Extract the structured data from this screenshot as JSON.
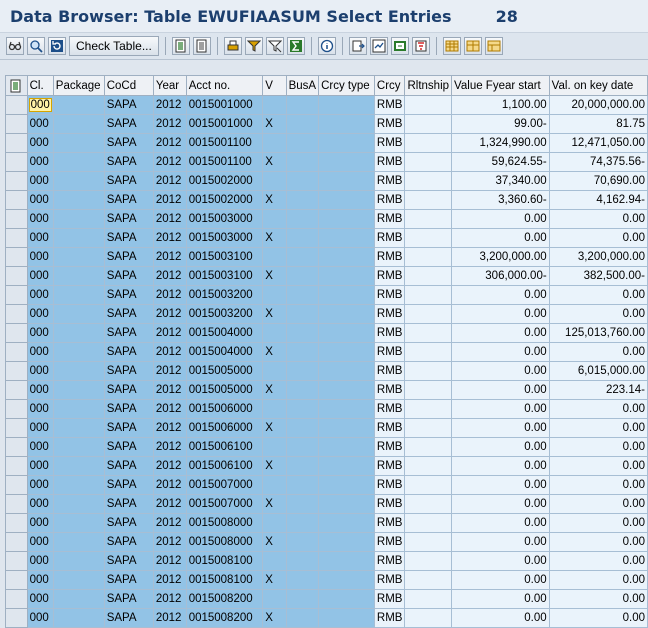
{
  "window": {
    "title": "Data Browser: Table EWUFIAASUM Select Entries",
    "count": "28"
  },
  "toolbar": {
    "icons": [
      "glasses-icon",
      "detail-icon",
      "refresh-icon",
      "check-table-button",
      "select-icon",
      "deselect-icon",
      "print-icon",
      "filter-icon",
      "filter-alt-icon",
      "sum-icon",
      "info-icon",
      "export-icon",
      "spreadsheet-icon",
      "local-file-icon",
      "sort-icon",
      "grid-icon",
      "layout-icon",
      "layout-alt-icon"
    ],
    "check_table_label": "Check Table..."
  },
  "table": {
    "columns": [
      "Cl.",
      "Package",
      "CoCd",
      "Year",
      "Acct no.",
      "V",
      "BusA",
      "Crcy type",
      "Crcy",
      "Rltnship",
      "Value Fyear start",
      "Val. on key date"
    ],
    "rows": [
      [
        "000",
        "",
        "SAPA",
        "2012",
        "0015001000",
        "",
        "",
        "",
        "RMB",
        "",
        "1,100.00",
        "20,000,000.00"
      ],
      [
        "000",
        "",
        "SAPA",
        "2012",
        "0015001000",
        "X",
        "",
        "",
        "RMB",
        "",
        "99.00-",
        "81.75"
      ],
      [
        "000",
        "",
        "SAPA",
        "2012",
        "0015001100",
        "",
        "",
        "",
        "RMB",
        "",
        "1,324,990.00",
        "12,471,050.00"
      ],
      [
        "000",
        "",
        "SAPA",
        "2012",
        "0015001100",
        "X",
        "",
        "",
        "RMB",
        "",
        "59,624.55-",
        "74,375.56-"
      ],
      [
        "000",
        "",
        "SAPA",
        "2012",
        "0015002000",
        "",
        "",
        "",
        "RMB",
        "",
        "37,340.00",
        "70,690.00"
      ],
      [
        "000",
        "",
        "SAPA",
        "2012",
        "0015002000",
        "X",
        "",
        "",
        "RMB",
        "",
        "3,360.60-",
        "4,162.94-"
      ],
      [
        "000",
        "",
        "SAPA",
        "2012",
        "0015003000",
        "",
        "",
        "",
        "RMB",
        "",
        "0.00",
        "0.00"
      ],
      [
        "000",
        "",
        "SAPA",
        "2012",
        "0015003000",
        "X",
        "",
        "",
        "RMB",
        "",
        "0.00",
        "0.00"
      ],
      [
        "000",
        "",
        "SAPA",
        "2012",
        "0015003100",
        "",
        "",
        "",
        "RMB",
        "",
        "3,200,000.00",
        "3,200,000.00"
      ],
      [
        "000",
        "",
        "SAPA",
        "2012",
        "0015003100",
        "X",
        "",
        "",
        "RMB",
        "",
        "306,000.00-",
        "382,500.00-"
      ],
      [
        "000",
        "",
        "SAPA",
        "2012",
        "0015003200",
        "",
        "",
        "",
        "RMB",
        "",
        "0.00",
        "0.00"
      ],
      [
        "000",
        "",
        "SAPA",
        "2012",
        "0015003200",
        "X",
        "",
        "",
        "RMB",
        "",
        "0.00",
        "0.00"
      ],
      [
        "000",
        "",
        "SAPA",
        "2012",
        "0015004000",
        "",
        "",
        "",
        "RMB",
        "",
        "0.00",
        "125,013,760.00"
      ],
      [
        "000",
        "",
        "SAPA",
        "2012",
        "0015004000",
        "X",
        "",
        "",
        "RMB",
        "",
        "0.00",
        "0.00"
      ],
      [
        "000",
        "",
        "SAPA",
        "2012",
        "0015005000",
        "",
        "",
        "",
        "RMB",
        "",
        "0.00",
        "6,015,000.00"
      ],
      [
        "000",
        "",
        "SAPA",
        "2012",
        "0015005000",
        "X",
        "",
        "",
        "RMB",
        "",
        "0.00",
        "223.14-"
      ],
      [
        "000",
        "",
        "SAPA",
        "2012",
        "0015006000",
        "",
        "",
        "",
        "RMB",
        "",
        "0.00",
        "0.00"
      ],
      [
        "000",
        "",
        "SAPA",
        "2012",
        "0015006000",
        "X",
        "",
        "",
        "RMB",
        "",
        "0.00",
        "0.00"
      ],
      [
        "000",
        "",
        "SAPA",
        "2012",
        "0015006100",
        "",
        "",
        "",
        "RMB",
        "",
        "0.00",
        "0.00"
      ],
      [
        "000",
        "",
        "SAPA",
        "2012",
        "0015006100",
        "X",
        "",
        "",
        "RMB",
        "",
        "0.00",
        "0.00"
      ],
      [
        "000",
        "",
        "SAPA",
        "2012",
        "0015007000",
        "",
        "",
        "",
        "RMB",
        "",
        "0.00",
        "0.00"
      ],
      [
        "000",
        "",
        "SAPA",
        "2012",
        "0015007000",
        "X",
        "",
        "",
        "RMB",
        "",
        "0.00",
        "0.00"
      ],
      [
        "000",
        "",
        "SAPA",
        "2012",
        "0015008000",
        "",
        "",
        "",
        "RMB",
        "",
        "0.00",
        "0.00"
      ],
      [
        "000",
        "",
        "SAPA",
        "2012",
        "0015008000",
        "X",
        "",
        "",
        "RMB",
        "",
        "0.00",
        "0.00"
      ],
      [
        "000",
        "",
        "SAPA",
        "2012",
        "0015008100",
        "",
        "",
        "",
        "RMB",
        "",
        "0.00",
        "0.00"
      ],
      [
        "000",
        "",
        "SAPA",
        "2012",
        "0015008100",
        "X",
        "",
        "",
        "RMB",
        "",
        "0.00",
        "0.00"
      ],
      [
        "000",
        "",
        "SAPA",
        "2012",
        "0015008200",
        "",
        "",
        "",
        "RMB",
        "",
        "0.00",
        "0.00"
      ],
      [
        "000",
        "",
        "SAPA",
        "2012",
        "0015008200",
        "X",
        "",
        "",
        "RMB",
        "",
        "0.00",
        "0.00"
      ]
    ]
  }
}
